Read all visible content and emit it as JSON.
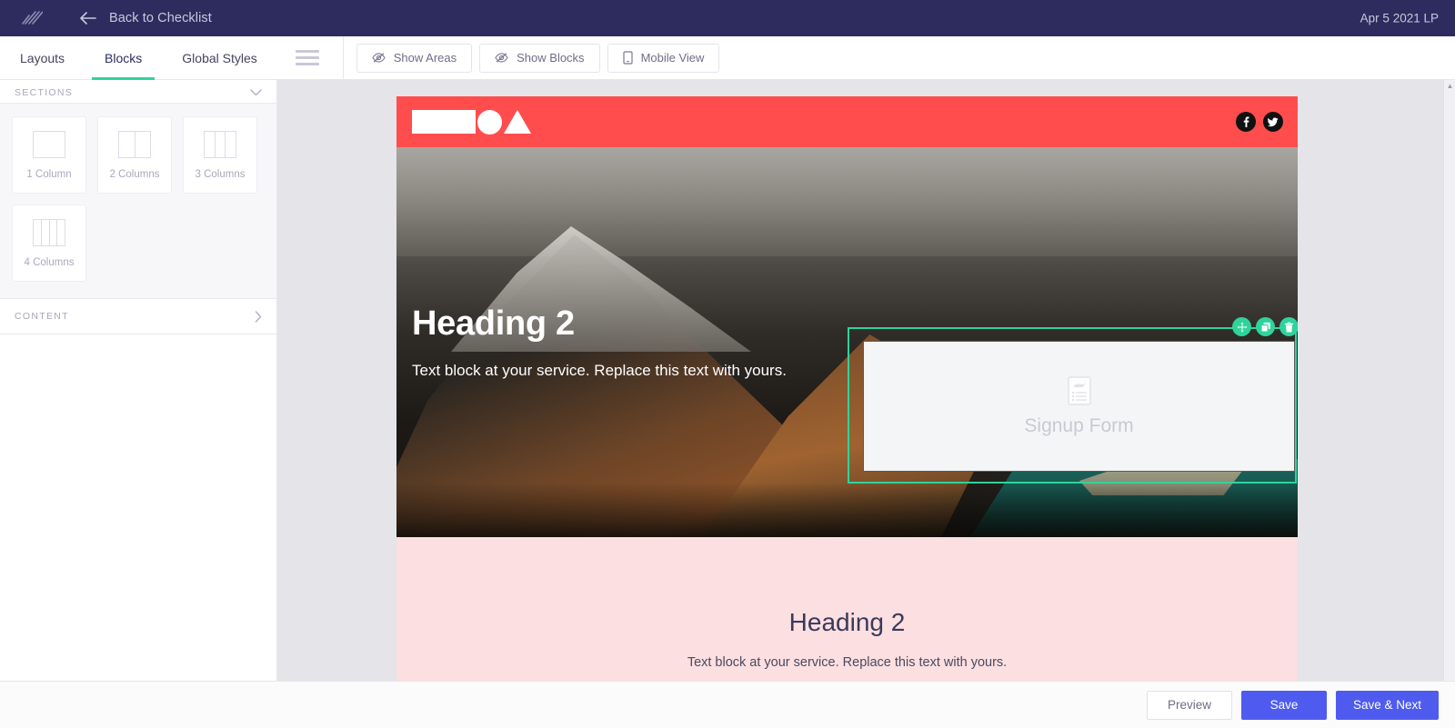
{
  "topbar": {
    "logo_icon": "brand-slash-lines-logo",
    "back_icon": "arrow-left-icon",
    "back_label": "Back to Checklist",
    "date_label": "Apr 5 2021 LP"
  },
  "toolbar": {
    "tabs": [
      {
        "label": "Layouts",
        "active": false
      },
      {
        "label": "Blocks",
        "active": true
      },
      {
        "label": "Global Styles",
        "active": false
      }
    ],
    "menu_icon": "hamburger-icon",
    "buttons": [
      {
        "label": "Show Areas",
        "icon": "eye-slash-icon"
      },
      {
        "label": "Show Blocks",
        "icon": "eye-slash-icon"
      },
      {
        "label": "Mobile View",
        "icon": "mobile-phone-icon"
      }
    ]
  },
  "sidebar": {
    "sections": {
      "title": "SECTIONS",
      "chevron_icon": "chevron-down-icon",
      "cards": [
        {
          "label": "1 Column",
          "columns": 1
        },
        {
          "label": "2 Columns",
          "columns": 2
        },
        {
          "label": "3 Columns",
          "columns": 3
        },
        {
          "label": "4 Columns",
          "columns": 4
        }
      ]
    },
    "content": {
      "title": "CONTENT",
      "chevron_icon": "chevron-right-icon"
    }
  },
  "canvas": {
    "site_nav": {
      "logo_shapes": [
        "rectangle",
        "circle",
        "triangle"
      ],
      "background_color": "#ff4d4d",
      "socials": [
        {
          "name": "facebook-icon",
          "glyph": "f"
        },
        {
          "name": "twitter-icon",
          "glyph": "t"
        }
      ]
    },
    "hero": {
      "heading": "Heading 2",
      "paragraph": "Text block at your service. Replace this text with yours."
    },
    "selected_block": {
      "label": "Signup Form",
      "placeholder_icon": "signup-form-icon",
      "outline_color": "#2fd39b",
      "actions": [
        {
          "name": "move-handle",
          "icon": "move-arrows-icon"
        },
        {
          "name": "duplicate-button",
          "icon": "copy-icon"
        },
        {
          "name": "delete-button",
          "icon": "trash-icon"
        }
      ]
    },
    "pink_section": {
      "heading": "Heading 2",
      "paragraph": "Text block at your service. Replace this text with yours.",
      "background_color": "#fcdfe0"
    }
  },
  "bottombar": {
    "preview_label": "Preview",
    "save_label": "Save",
    "save_next_label": "Save & Next",
    "primary_color": "#4f5bef"
  }
}
